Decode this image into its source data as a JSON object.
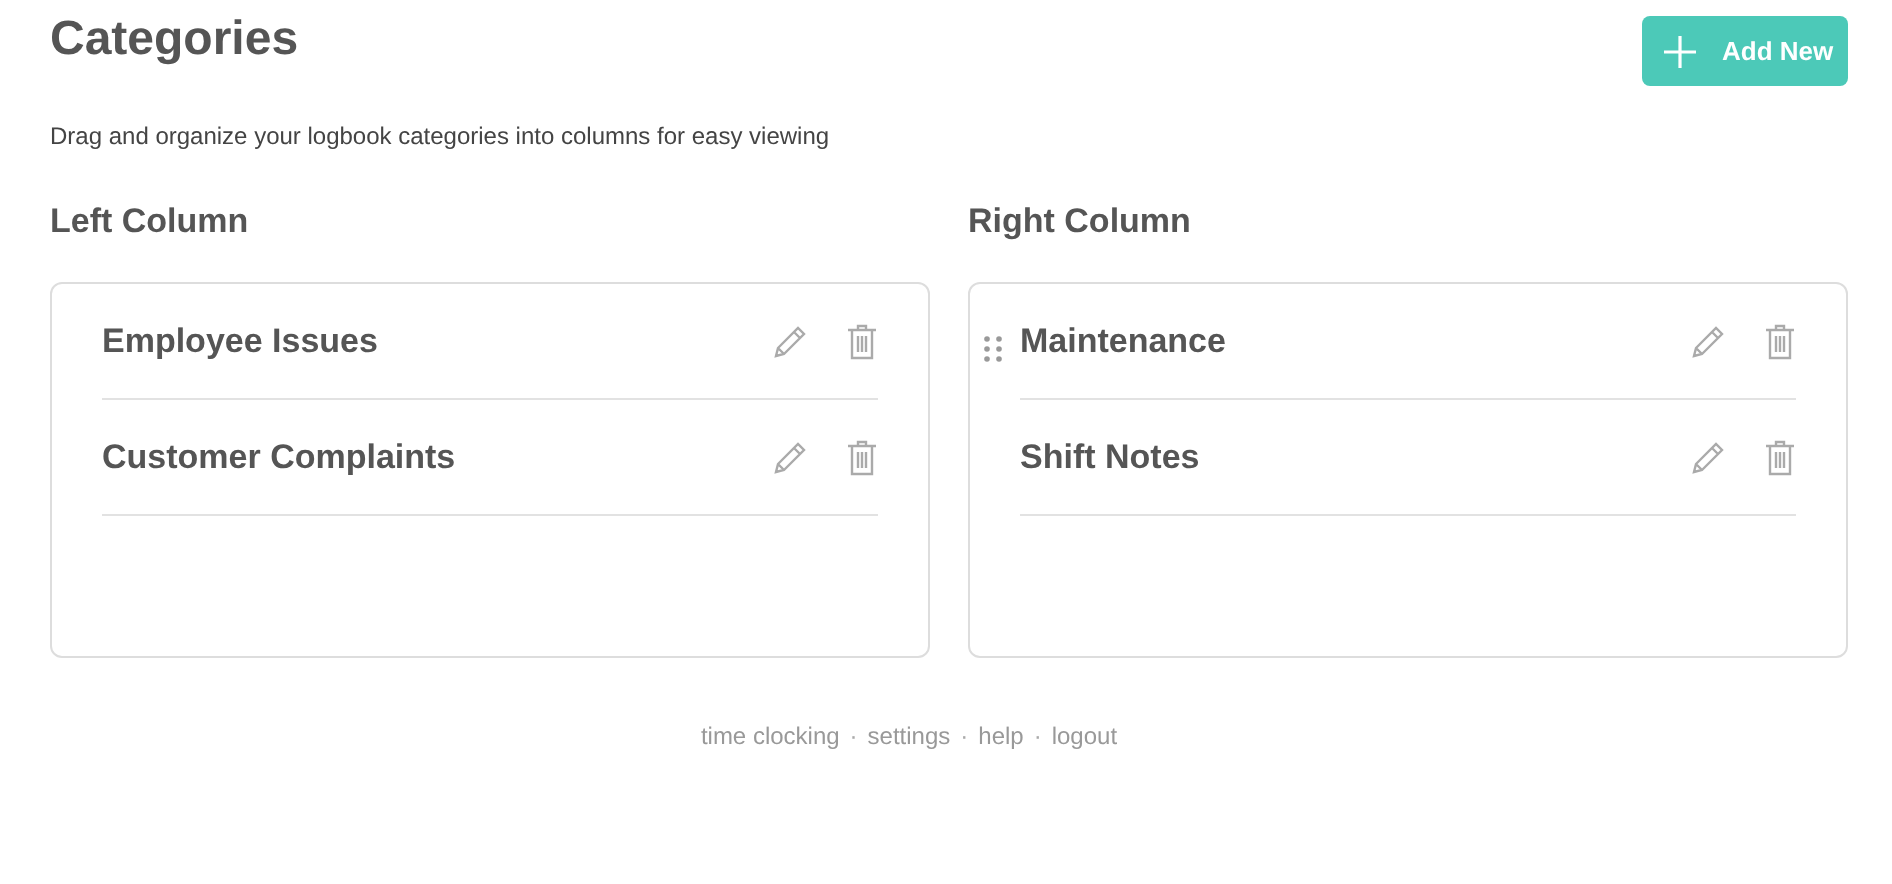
{
  "header": {
    "title": "Categories",
    "add_button": "Add New"
  },
  "description": "Drag and organize your logbook categories into columns for easy viewing",
  "columns": [
    {
      "title": "Left Column",
      "items": [
        {
          "name": "Employee Issues",
          "hovered": false
        },
        {
          "name": "Customer Complaints",
          "hovered": false
        }
      ]
    },
    {
      "title": "Right Column",
      "items": [
        {
          "name": "Maintenance",
          "hovered": true
        },
        {
          "name": "Shift Notes",
          "hovered": false
        }
      ]
    }
  ],
  "footer": [
    {
      "kind": "link",
      "text": "time clocking"
    },
    {
      "kind": "separator",
      "text": "·"
    },
    {
      "kind": "link",
      "text": "settings"
    },
    {
      "kind": "separator",
      "text": "·"
    },
    {
      "kind": "link",
      "text": "help"
    },
    {
      "kind": "separator",
      "text": "·"
    },
    {
      "kind": "link",
      "text": "logout"
    }
  ]
}
